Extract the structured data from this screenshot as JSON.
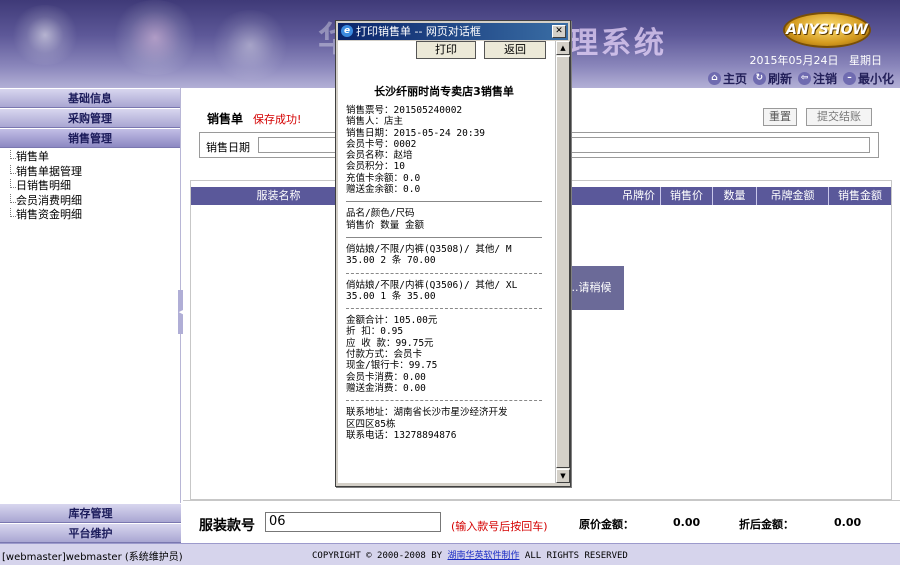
{
  "header": {
    "title_left": "华",
    "title_right": "理系统",
    "logo": "ANYSHOW",
    "date": "2015年05月24日",
    "weekday": "星期日",
    "toolbar": [
      "主页",
      "刷新",
      "注销",
      "最小化"
    ]
  },
  "sidebar": {
    "menu_basic": "基础信息",
    "menu_purchase": "采购管理",
    "menu_sales": "销售管理",
    "sub_items": [
      "销售单",
      "销售单据管理",
      "日销售明细",
      "会员消费明细",
      "销售资金明细"
    ],
    "menu_inventory": "库存管理",
    "menu_platform": "平台维护"
  },
  "main": {
    "form_title": "销售单",
    "save_msg": "保存成功!",
    "btn_reset": "重置",
    "btn_submit": "提交结账",
    "date_label": "销售日期",
    "grid_columns": [
      "服装名称",
      "吊牌价",
      "销售价",
      "数量",
      "吊牌金额",
      "销售金额"
    ],
    "loading": "...请稍候",
    "sku_label": "服装款号",
    "sku_value": "06",
    "sku_hint": "(输入款号后按回车)",
    "orig_label": "原价金额：",
    "orig_value": "0.00",
    "disc_label": "折后金额：",
    "disc_value": "0.00"
  },
  "dialog": {
    "title": "打印销售单 -- 网页对话框",
    "btn_print": "打印",
    "btn_back": "返回",
    "receipt_title": "长沙纤丽时尚专卖店3销售单",
    "info": [
      "销售票号：201505240002",
      "销售人：店主",
      "销售日期：2015-05-24 20:39",
      "会员卡号：0002",
      "会员名称：赵培",
      "会员积分：10",
      "充值卡余额：0.0",
      "赠送金余额：0.0"
    ],
    "table_head": [
      "品名/颜色/尺码",
      "销售价     数量     金额"
    ],
    "item1": [
      "俏姑娘/不限/内裤(Q3508)/ 其他/ M",
      "35.00    2 条    70.00"
    ],
    "item2": [
      "俏姑娘/不限/内裤(Q3506)/ 其他/ XL",
      "35.00    1 条    35.00"
    ],
    "summary": [
      "金额合计：105.00元",
      "折    扣：0.95",
      "应 收 款：99.75元",
      "付款方式：会员卡",
      "现金/银行卡：99.75",
      "会员卡消费：0.00",
      "赠送金消费：0.00"
    ],
    "contact": [
      "联系地址：湖南省长沙市星沙经济开发",
      "区四区85栋",
      "联系电话：13278894876"
    ]
  },
  "footer": {
    "user": "[webmaster]webmaster (系统维护员)",
    "copy_pre": "COPYRIGHT © 2000-2008 BY ",
    "copy_link": "湖南华英软件制作",
    "copy_post": " ALL RIGHTS RESERVED"
  }
}
